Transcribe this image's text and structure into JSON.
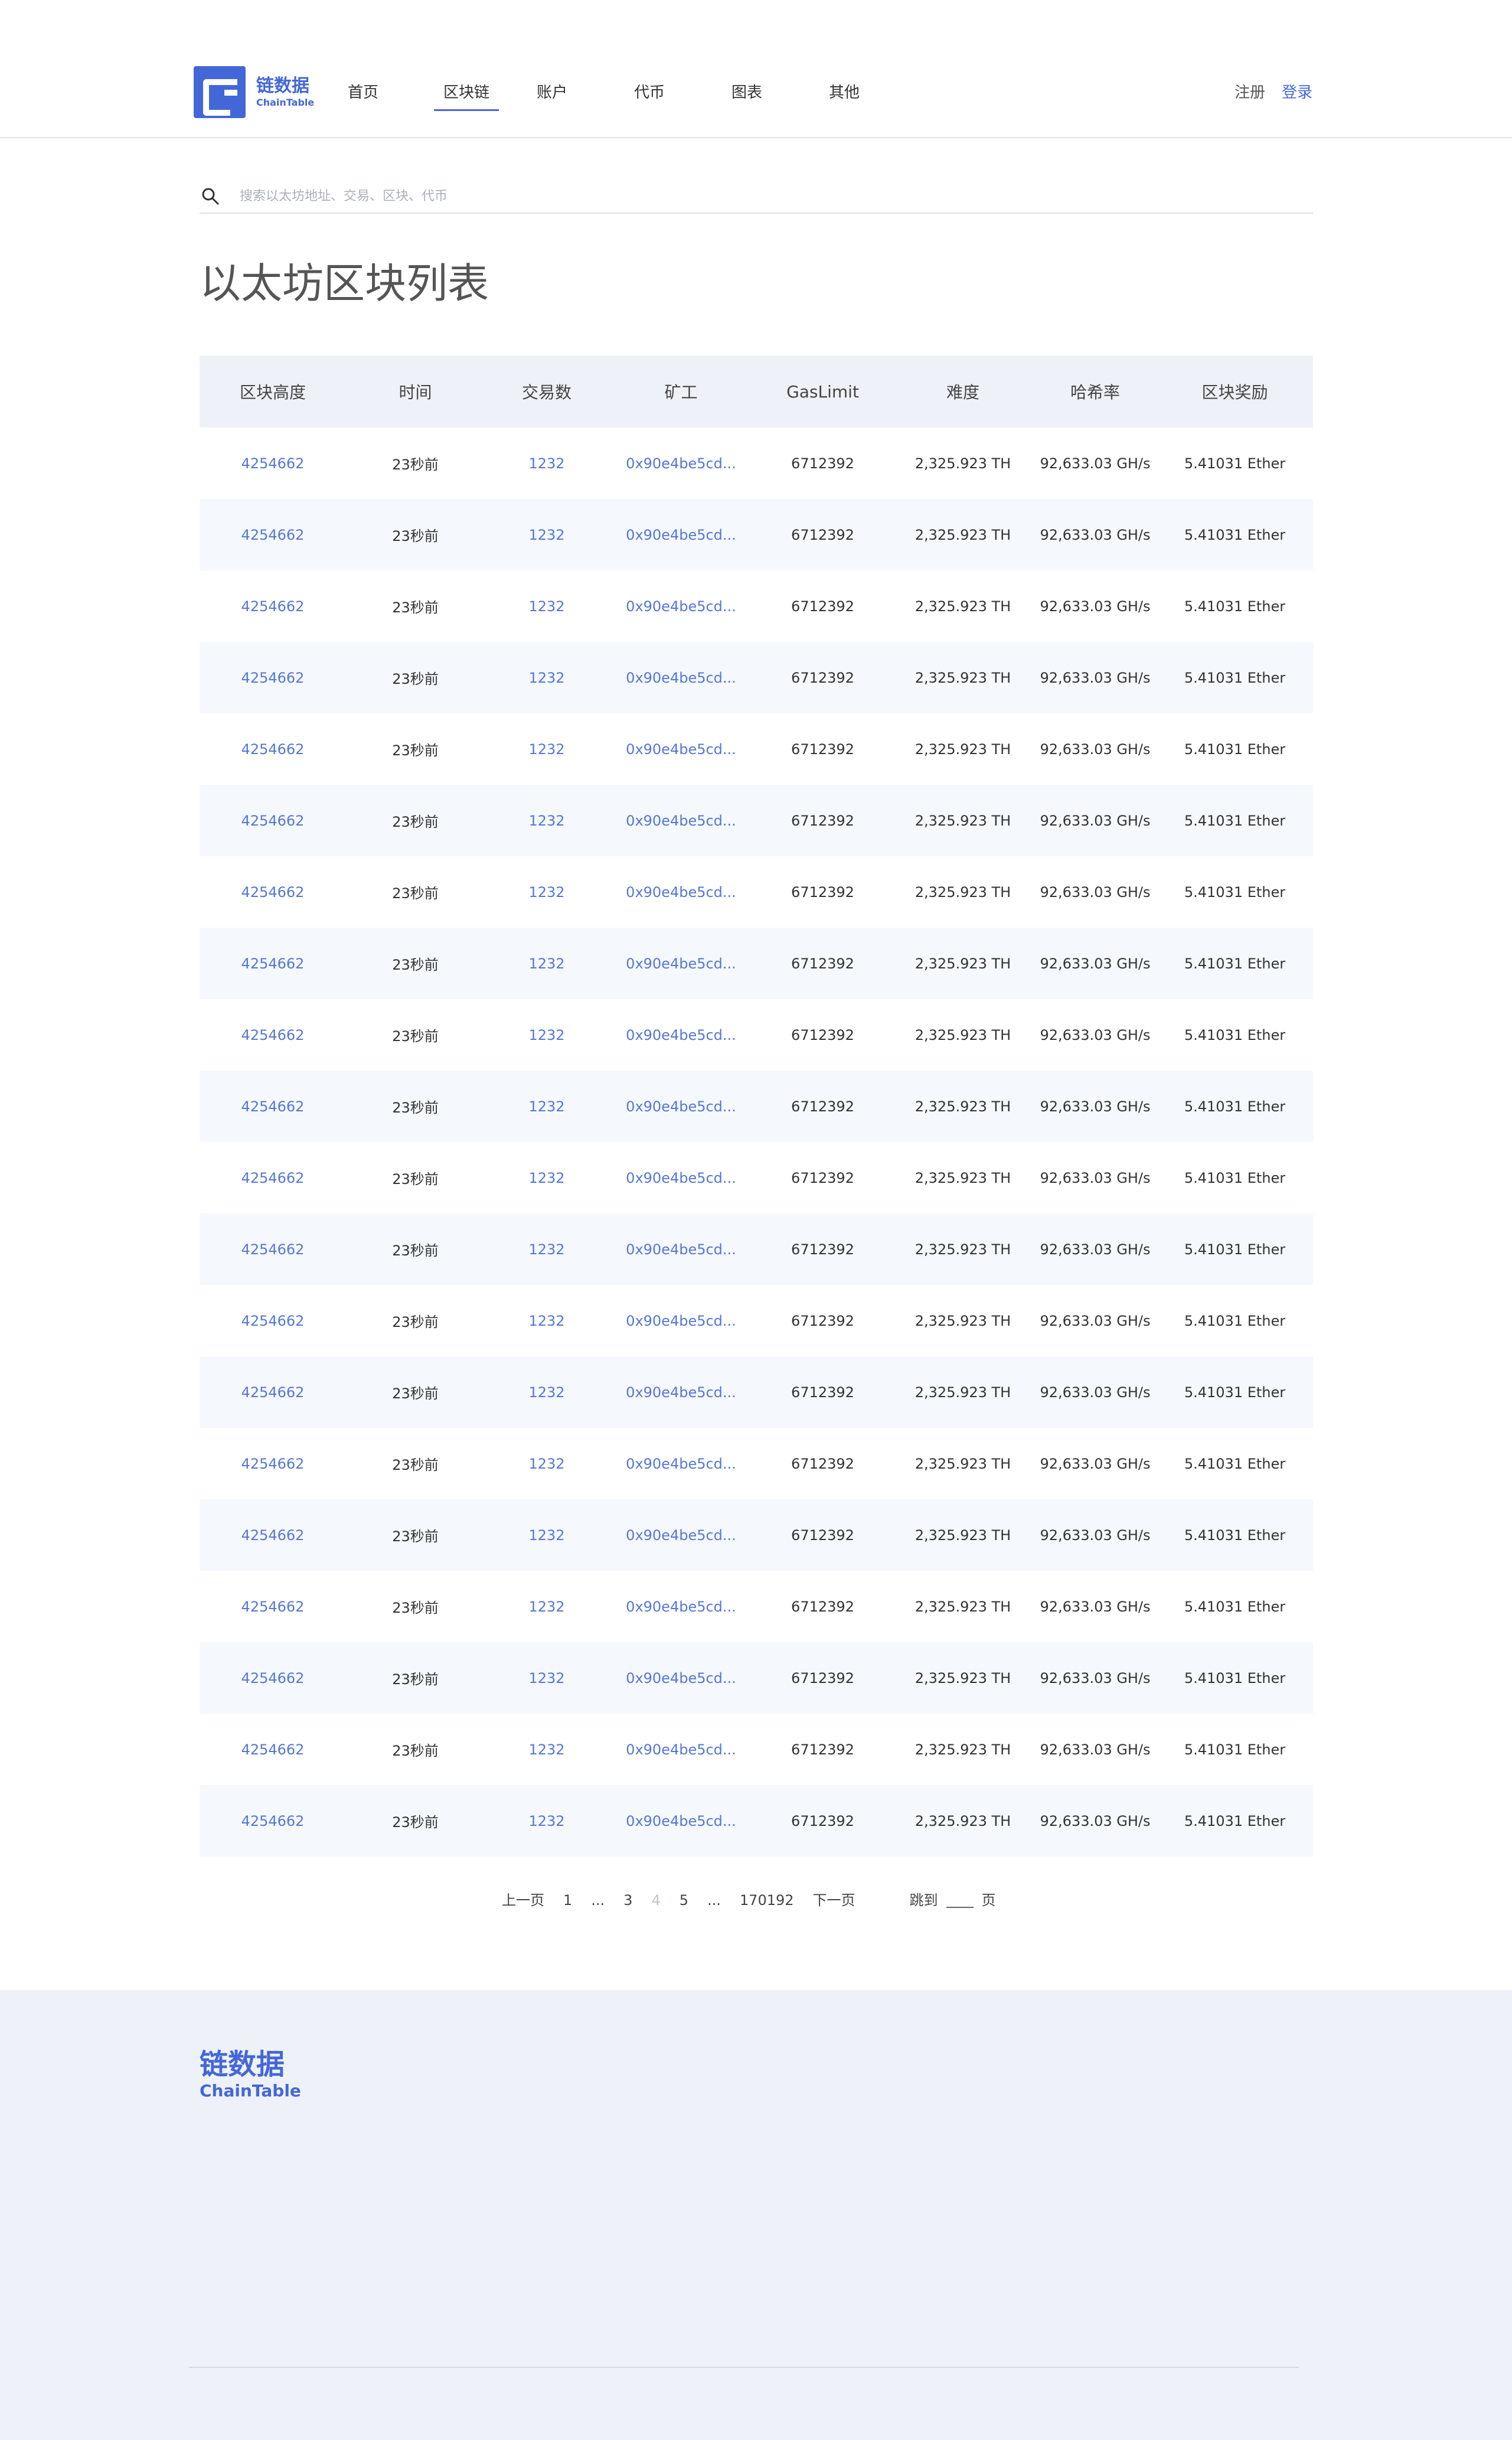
{
  "brand": {
    "name_cn": "链数据",
    "name_en": "ChainTable",
    "color": "#4467d8"
  },
  "nav": {
    "items": [
      {
        "label": "首页",
        "width": 120
      },
      {
        "label": "区块链",
        "width": 150,
        "active": true
      },
      {
        "label": "账户",
        "width": 165
      },
      {
        "label": "代币",
        "width": 165
      },
      {
        "label": "图表",
        "width": 165
      },
      {
        "label": "其他",
        "width": 165
      }
    ]
  },
  "auth": {
    "register": "注册",
    "login": "登录"
  },
  "search": {
    "placeholder": "搜索以太坊地址、交易、区块、代币"
  },
  "page_title": "以太坊区块列表",
  "table": {
    "headers": [
      "区块高度",
      "时间",
      "交易数",
      "矿工",
      "GasLimit",
      "难度",
      "哈希率",
      "区块奖励"
    ],
    "rows": [
      [
        "4254662",
        "23秒前",
        "1232",
        "0x90e4be5cd...",
        "6712392",
        "2,325.923 TH",
        "92,633.03 GH/s",
        "5.41031 Ether"
      ],
      [
        "4254662",
        "23秒前",
        "1232",
        "0x90e4be5cd...",
        "6712392",
        "2,325.923 TH",
        "92,633.03 GH/s",
        "5.41031 Ether"
      ],
      [
        "4254662",
        "23秒前",
        "1232",
        "0x90e4be5cd...",
        "6712392",
        "2,325.923 TH",
        "92,633.03 GH/s",
        "5.41031 Ether"
      ],
      [
        "4254662",
        "23秒前",
        "1232",
        "0x90e4be5cd...",
        "6712392",
        "2,325.923 TH",
        "92,633.03 GH/s",
        "5.41031 Ether"
      ],
      [
        "4254662",
        "23秒前",
        "1232",
        "0x90e4be5cd...",
        "6712392",
        "2,325.923 TH",
        "92,633.03 GH/s",
        "5.41031 Ether"
      ],
      [
        "4254662",
        "23秒前",
        "1232",
        "0x90e4be5cd...",
        "6712392",
        "2,325.923 TH",
        "92,633.03 GH/s",
        "5.41031 Ether"
      ],
      [
        "4254662",
        "23秒前",
        "1232",
        "0x90e4be5cd...",
        "6712392",
        "2,325.923 TH",
        "92,633.03 GH/s",
        "5.41031 Ether"
      ],
      [
        "4254662",
        "23秒前",
        "1232",
        "0x90e4be5cd...",
        "6712392",
        "2,325.923 TH",
        "92,633.03 GH/s",
        "5.41031 Ether"
      ],
      [
        "4254662",
        "23秒前",
        "1232",
        "0x90e4be5cd...",
        "6712392",
        "2,325.923 TH",
        "92,633.03 GH/s",
        "5.41031 Ether"
      ],
      [
        "4254662",
        "23秒前",
        "1232",
        "0x90e4be5cd...",
        "6712392",
        "2,325.923 TH",
        "92,633.03 GH/s",
        "5.41031 Ether"
      ],
      [
        "4254662",
        "23秒前",
        "1232",
        "0x90e4be5cd...",
        "6712392",
        "2,325.923 TH",
        "92,633.03 GH/s",
        "5.41031 Ether"
      ],
      [
        "4254662",
        "23秒前",
        "1232",
        "0x90e4be5cd...",
        "6712392",
        "2,325.923 TH",
        "92,633.03 GH/s",
        "5.41031 Ether"
      ],
      [
        "4254662",
        "23秒前",
        "1232",
        "0x90e4be5cd...",
        "6712392",
        "2,325.923 TH",
        "92,633.03 GH/s",
        "5.41031 Ether"
      ],
      [
        "4254662",
        "23秒前",
        "1232",
        "0x90e4be5cd...",
        "6712392",
        "2,325.923 TH",
        "92,633.03 GH/s",
        "5.41031 Ether"
      ],
      [
        "4254662",
        "23秒前",
        "1232",
        "0x90e4be5cd...",
        "6712392",
        "2,325.923 TH",
        "92,633.03 GH/s",
        "5.41031 Ether"
      ],
      [
        "4254662",
        "23秒前",
        "1232",
        "0x90e4be5cd...",
        "6712392",
        "2,325.923 TH",
        "92,633.03 GH/s",
        "5.41031 Ether"
      ],
      [
        "4254662",
        "23秒前",
        "1232",
        "0x90e4be5cd...",
        "6712392",
        "2,325.923 TH",
        "92,633.03 GH/s",
        "5.41031 Ether"
      ],
      [
        "4254662",
        "23秒前",
        "1232",
        "0x90e4be5cd...",
        "6712392",
        "2,325.923 TH",
        "92,633.03 GH/s",
        "5.41031 Ether"
      ],
      [
        "4254662",
        "23秒前",
        "1232",
        "0x90e4be5cd...",
        "6712392",
        "2,325.923 TH",
        "92,633.03 GH/s",
        "5.41031 Ether"
      ],
      [
        "4254662",
        "23秒前",
        "1232",
        "0x90e4be5cd...",
        "6712392",
        "2,325.923 TH",
        "92,633.03 GH/s",
        "5.41031 Ether"
      ]
    ],
    "link_columns": [
      0,
      2,
      3
    ],
    "link_color": "#5577d6"
  },
  "pagination": {
    "prev": "上一页",
    "items": [
      "1",
      "...",
      "3",
      "4",
      "5",
      "...",
      "170192"
    ],
    "current": "4",
    "next": "下一页",
    "jump_prefix": "跳到",
    "jump_suffix": "页"
  }
}
